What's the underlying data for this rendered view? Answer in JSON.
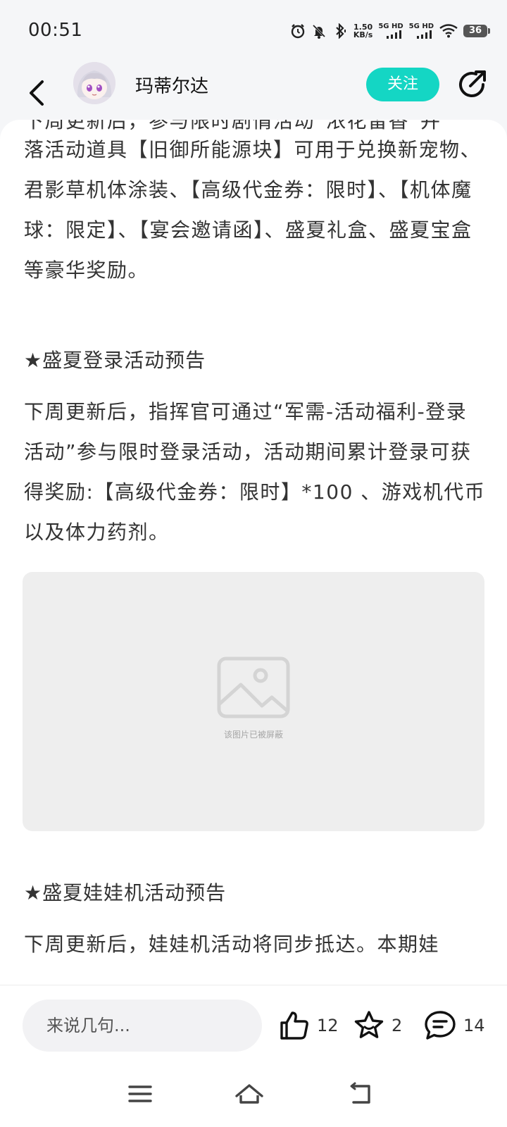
{
  "status_bar": {
    "time": "00:51",
    "net_speed_value": "1.50",
    "net_speed_unit": "KB/s",
    "sim1_label": "5G HD",
    "sim2_label": "5G HD",
    "battery": "36",
    "icons": [
      "alarm-icon",
      "mute-icon",
      "bluetooth-icon",
      "signal-icon",
      "wifi-icon",
      "battery-icon"
    ]
  },
  "header": {
    "author_name": "玛蒂尔达",
    "follow_label": "关注",
    "icons": [
      "back-icon",
      "avatar",
      "share-icon"
    ]
  },
  "article": {
    "para_partial_top": "下周更新后，参与限时剧情活动“浓花留香”并",
    "para_1": "落活动道具【旧御所能源块】可用于兑换新宠物、君影草机体涂装、【高级代金券：限时】、【机体魔球：限定】、【宴会邀请函】、盛夏礼盒、盛夏宝盒等豪华奖励。",
    "heading_1": "★盛夏登录活动预告",
    "para_2": "下周更新后，指挥官可通过“军需-活动福利-登录活动”参与限时登录活动，活动期间累计登录可获得奖励:【高级代金券：限时】*100 、游戏机代币以及体力药剂。",
    "blocked_image_text": "该图片已被屏蔽",
    "heading_2": "★盛夏娃娃机活动预告",
    "para_3": "下周更新后，娃娃机活动将同步抵达。本期娃"
  },
  "bottom_bar": {
    "comment_placeholder": "来说几句...",
    "like_count": "12",
    "favorite_count": "2",
    "comment_count": "14"
  },
  "colors": {
    "accent": "#14d6c4",
    "page_bg": "#f5f6f8",
    "card_bg": "#ffffff",
    "text": "#333333",
    "image_placeholder": "#eeeeee"
  }
}
